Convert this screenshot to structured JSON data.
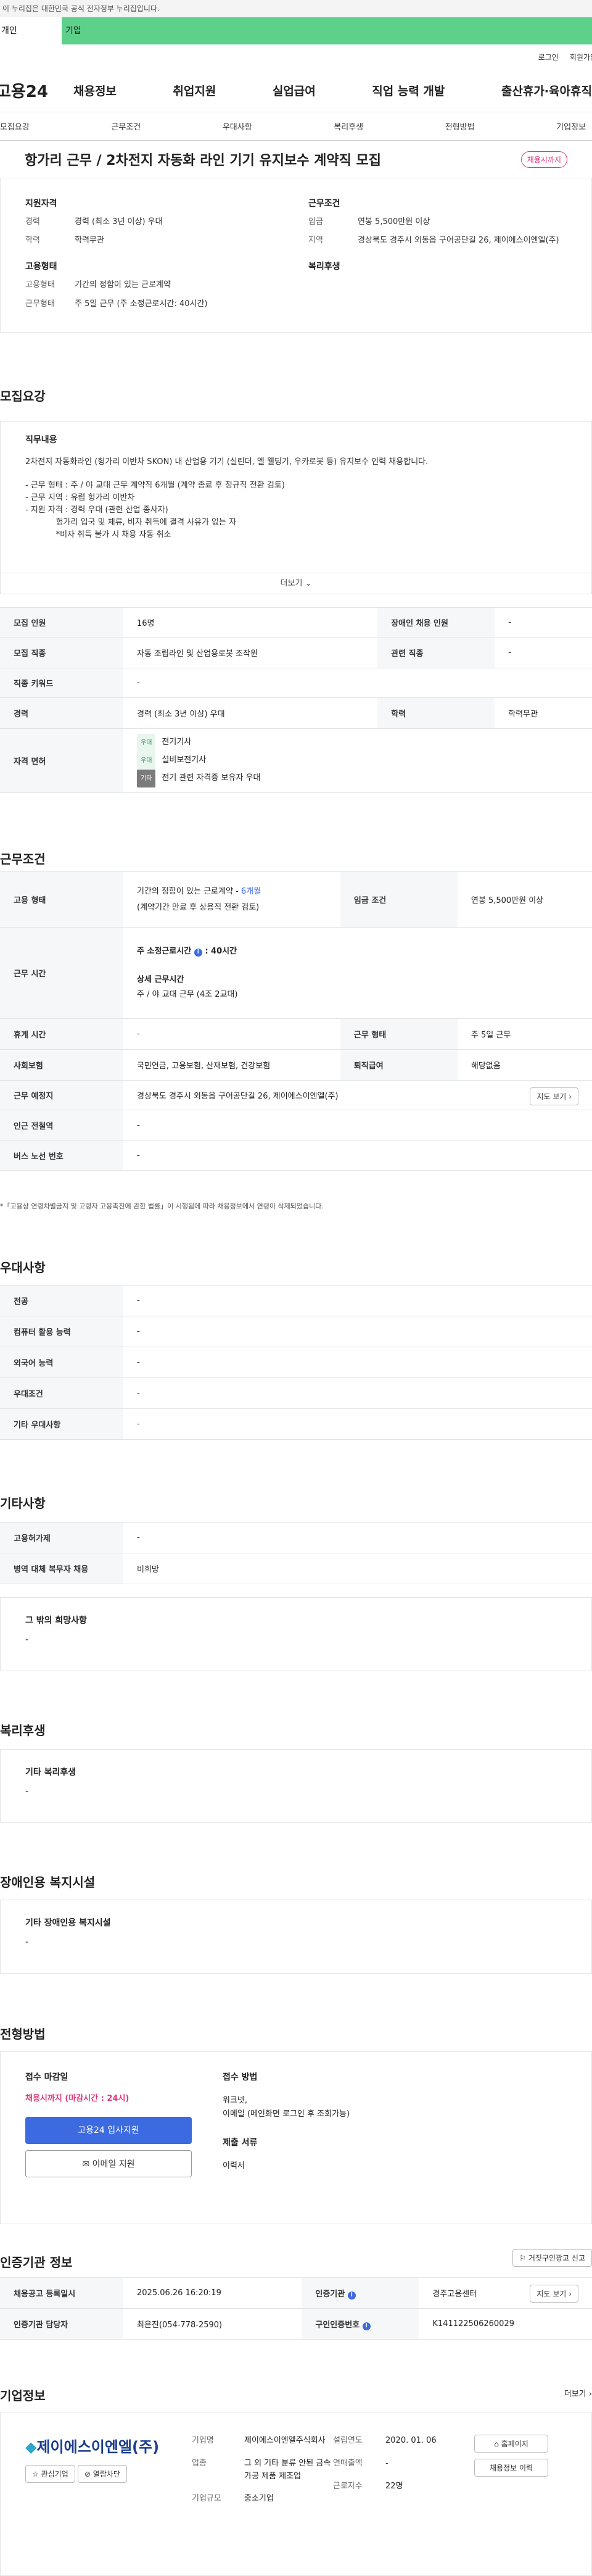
{
  "notice": "이 누리집은 대한민국 공식 전자정부 누리집입니다.",
  "tabs": {
    "personal": "개인",
    "company": "기업"
  },
  "util": {
    "login": "로그인",
    "signup": "회원가입"
  },
  "gnb": {
    "logo": "고용24",
    "menu": [
      "채용정보",
      "취업지원",
      "실업급여",
      "직업 능력 개발",
      "출산휴가·육아휴직"
    ]
  },
  "subtabs": [
    "모집요강",
    "근무조건",
    "우대사항",
    "복리후생",
    "전형방법",
    "기업정보"
  ],
  "job": {
    "title": "항가리 근무 / 2차전지 자동화 라인 기기 유지보수 계약직 모집",
    "status": "채용시까지",
    "summary": {
      "qual": {
        "h": "지원자격",
        "rows": [
          [
            "경력",
            "경력 (최소 3년 이상) 우대"
          ],
          [
            "학력",
            "학력무관"
          ]
        ]
      },
      "cond": {
        "h": "근무조건",
        "rows": [
          [
            "임금",
            "연봉 5,500만원 이상"
          ],
          [
            "지역",
            "경상북도 경주시 외동읍 구어공단길 26, 제이에스이엔엘(주)"
          ]
        ]
      },
      "emp": {
        "h": "고용형태",
        "rows": [
          [
            "고용형태",
            "기간의 정함이 있는 근로계약"
          ],
          [
            "근무형태",
            "주 5일 근무 (주 소정근로시간: 40시간)"
          ]
        ]
      },
      "welfare": {
        "h": "복리후생"
      }
    }
  },
  "recruit": {
    "title": "모집요강",
    "duty_h": "직무내용",
    "duty_lines": [
      "2차전지 자동화라인 (헝가리 이반차 SKON) 내 산업용 기기 (실린더, 엘 웰딩기, 우카로봇 등) 유지보수 인력 채용합니다.",
      "",
      "- 근무 형태 : 주 / 야 교대 근무 계약직 6개월 (계약 종료 후 정규직 전환 검토)",
      "- 근무 지역 : 유럽 헝가리 이반차",
      "- 지원 자격 : 경력 우대 (관련 산업 종사자)",
      "            헝가리 입국 및 체류, 비자 취득에 결격 사유가 없는 자",
      "            *비자 취득 불가 시 채용 자동 취소"
    ],
    "more": "더보기",
    "rows": {
      "count_k": "모집 인원",
      "count_v": "16명",
      "dis_k": "장애인 채용 인원",
      "dis_v": "-",
      "job_k": "모집 직종",
      "job_v": "자동 조립라인 및 산업용로봇 조작원",
      "rel_k": "관련 직종",
      "rel_v": "-",
      "kw_k": "직종 키워드",
      "kw_v": "-",
      "career_k": "경력",
      "career_v": "경력 (최소 3년 이상) 우대",
      "edu_k": "학력",
      "edu_v": "학력무관",
      "lic_k": "자격 면허",
      "licenses": [
        {
          "tag": "우대",
          "name": "전기기사"
        },
        {
          "tag": "우대",
          "name": "설비보전기사"
        },
        {
          "tag": "기타",
          "name": "전기 관련 자격증 보유자 우대"
        }
      ]
    }
  },
  "work": {
    "title": "근무조건",
    "emp_k": "고용 형태",
    "emp_v1": "기간의 정함이 있는 근로계약 - ",
    "emp_v1b": "6개월",
    "emp_v2": "(계약기간 만료 후 상용직 전환 검토)",
    "wage_k": "임금 조건",
    "wage_v": "연봉 5,500만원 이상",
    "time_k": "근무 시간",
    "time_a": "주 소정근로시간",
    "time_b": ": 40시간",
    "time_c": "상세 근무시간",
    "time_d": "주 / 야 교대 근무 (4조 2교대)",
    "rest_k": "휴게 시간",
    "rest_v": "-",
    "form_k": "근무 형태",
    "form_v": "주 5일 근무",
    "ins_k": "사회보험",
    "ins_v": "국민연금, 고용보험, 산재보험, 건강보험",
    "ret_k": "퇴직급여",
    "ret_v": "해당없음",
    "place_k": "근무 예정지",
    "place_v": "경상북도 경주시 외동읍 구어공단길 26, 제이에스이엔엘(주)",
    "map": "지도 보기",
    "sub_k": "인근 전철역",
    "sub_v": "-",
    "bus_k": "버스 노선 번호",
    "bus_v": "-",
    "note": "*「고용상 연령차별금지 및 고령자 고용촉진에 관한 법률」이 시행됨에 따라 채용정보에서 연령이 삭제되었습니다."
  },
  "pref": {
    "title": "우대사항",
    "rows": [
      [
        "전공",
        "-"
      ],
      [
        "컴퓨터 활용 능력",
        "-"
      ],
      [
        "외국어 능력",
        "-"
      ],
      [
        "우대조건",
        "-"
      ],
      [
        "기타 우대사항",
        "-"
      ]
    ]
  },
  "etc": {
    "title": "기타사항",
    "rows": [
      [
        "고용허가제",
        "-"
      ],
      [
        "병역 대체 복무자 채용",
        "비희망"
      ]
    ],
    "hope_h": "그 밖의 희망사항",
    "hope_v": "-"
  },
  "welfare": {
    "title": "복리후생",
    "h": "기타 복리후생",
    "v": "-"
  },
  "disfac": {
    "title": "장애인용 복지시설",
    "h": "기타 장애인용 복지시설",
    "v": "-"
  },
  "apply": {
    "title": "전형방법",
    "deadline_h": "접수 마감일",
    "deadline_v": "채용시까지 (마감시간 : 24시)",
    "btn_apply": "고용24 입사지원",
    "btn_email": "이메일 지원",
    "method_h": "접수 방법",
    "method_v1": "워크넷,",
    "method_v2": "이메일 (메인화면 로그인 후 조회가능)",
    "docs_h": "제출 서류",
    "docs_v": "이력서"
  },
  "agency": {
    "title": "인증기관 정보",
    "report": "거짓구인광고 신고",
    "reg_k": "채용공고 등록일시",
    "reg_v": "2025.06.26 16:20:19",
    "ag_k": "인증기관",
    "ag_v": "경주고용센터",
    "map": "지도 보기",
    "mgr_k": "인증기관 담당자",
    "mgr_v": "최은진(054-778-2590)",
    "no_k": "구인인증번호",
    "no_v": "K141122506260029"
  },
  "company": {
    "title": "기업정보",
    "more": "더보기",
    "logo": "제이에스이엔엘(주)",
    "fav": "관심기업",
    "block": "열람차단",
    "name_k": "기업명",
    "name_v": "제이에스이엔엘주식회사",
    "ind_k": "업종",
    "ind_v": "그 외 기타 분류 안된 금속 가공 제품 제조업",
    "size_k": "기업규모",
    "size_v": "중소기업",
    "est_k": "설립연도",
    "est_v": "2020. 01. 06",
    "sales_k": "연매출액",
    "sales_v": "-",
    "emp_k": "근로자수",
    "emp_v": "22명",
    "home": "홈페이지",
    "jobs": "채용정보 이력"
  }
}
